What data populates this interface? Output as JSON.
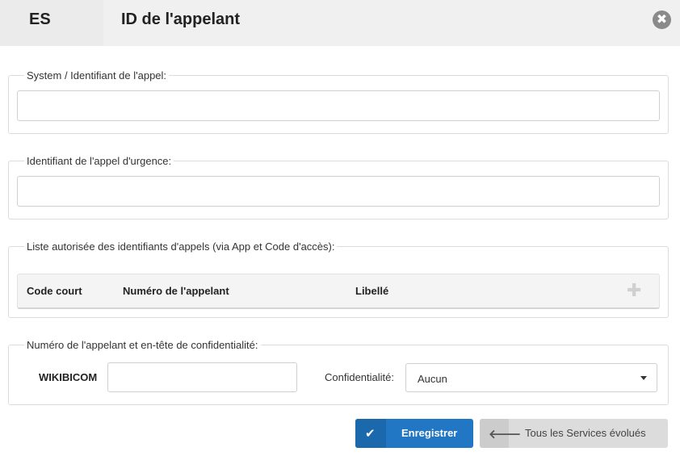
{
  "header": {
    "breadcrumb": "ES",
    "title": "ID de l'appelant",
    "close_icon": "✖"
  },
  "sections": {
    "system_id": {
      "legend": "System / Identifiant de l'appel:",
      "value": "",
      "placeholder": ""
    },
    "emergency_id": {
      "legend": "Identifiant de l'appel d'urgence:",
      "value": "",
      "placeholder": ""
    },
    "whitelist": {
      "legend": "Liste autorisée des identifiants d'appels (via App et Code d'accès):",
      "columns": [
        "Code court",
        "Numéro de l'appelant",
        "Libellé"
      ],
      "add_icon": "✚"
    },
    "privacy": {
      "legend": "Numéro de l'appelant et en-tête de confidentialité:",
      "prefix_label": "WIKIBICOM",
      "number_value": "",
      "confidentiality_label": "Confidentialité:",
      "confidentiality_value": "Aucun"
    }
  },
  "actions": {
    "save_label": "Enregistrer",
    "save_icon": "✔",
    "back_label": "Tous les Services évolués",
    "back_icon": "🡐"
  }
}
